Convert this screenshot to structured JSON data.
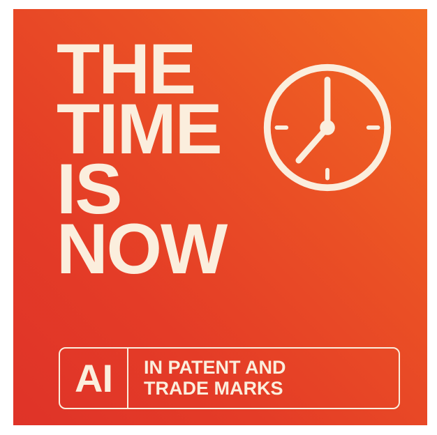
{
  "headline": {
    "lines": [
      "THE",
      "TIME",
      "IS",
      "NOW"
    ]
  },
  "clock_icon": "clock-icon",
  "tag": {
    "abbr": "AI",
    "line1": "IN PATENT AND",
    "line2": "TRADE MARKS"
  },
  "colors": {
    "background_top": "#f26a21",
    "background_bottom": "#df3328",
    "foreground": "#fbeedd"
  }
}
